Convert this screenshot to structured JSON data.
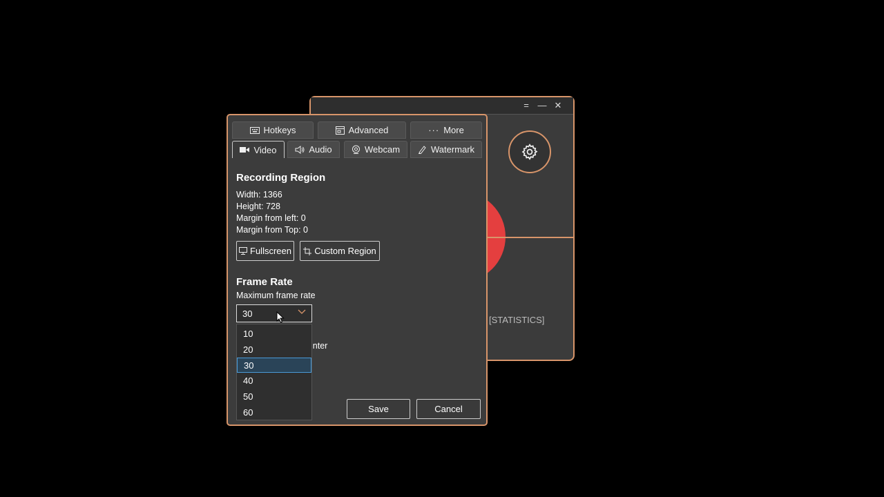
{
  "main_window": {
    "title_controls": [
      "=",
      "—",
      "✕"
    ],
    "statistics_label": "[STATISTICS]"
  },
  "tabs_top": [
    {
      "label": "Hotkeys",
      "icon": "keyboard-icon"
    },
    {
      "label": "Advanced",
      "icon": "window-icon"
    },
    {
      "label": "More",
      "icon": "dots-icon"
    }
  ],
  "tabs_bottom": [
    {
      "label": "Video",
      "icon": "camera-icon",
      "active": true
    },
    {
      "label": "Audio",
      "icon": "speaker-icon"
    },
    {
      "label": "Webcam",
      "icon": "webcam-icon"
    },
    {
      "label": "Watermark",
      "icon": "watermark-icon"
    }
  ],
  "recording_region": {
    "heading": "Recording Region",
    "width": "Width:  1366",
    "height": "Height:  728",
    "margin_left": "Margin from left:  0",
    "margin_top": "Margin from Top:  0",
    "fullscreen_label": "Fullscreen",
    "custom_region_label": "Custom Region"
  },
  "frame_rate": {
    "heading": "Frame Rate",
    "sublabel": "Maximum frame rate",
    "selected": "30",
    "options": [
      "10",
      "20",
      "30",
      "40",
      "50",
      "60"
    ],
    "partially_hidden_text": "inter"
  },
  "footer": {
    "save_label": "Save",
    "cancel_label": "Cancel"
  },
  "colors": {
    "accent": "#d8956a",
    "record_red": "#e43f3f",
    "background": "#000000",
    "panel": "#3c3c3c",
    "selection": "#2a4458"
  }
}
